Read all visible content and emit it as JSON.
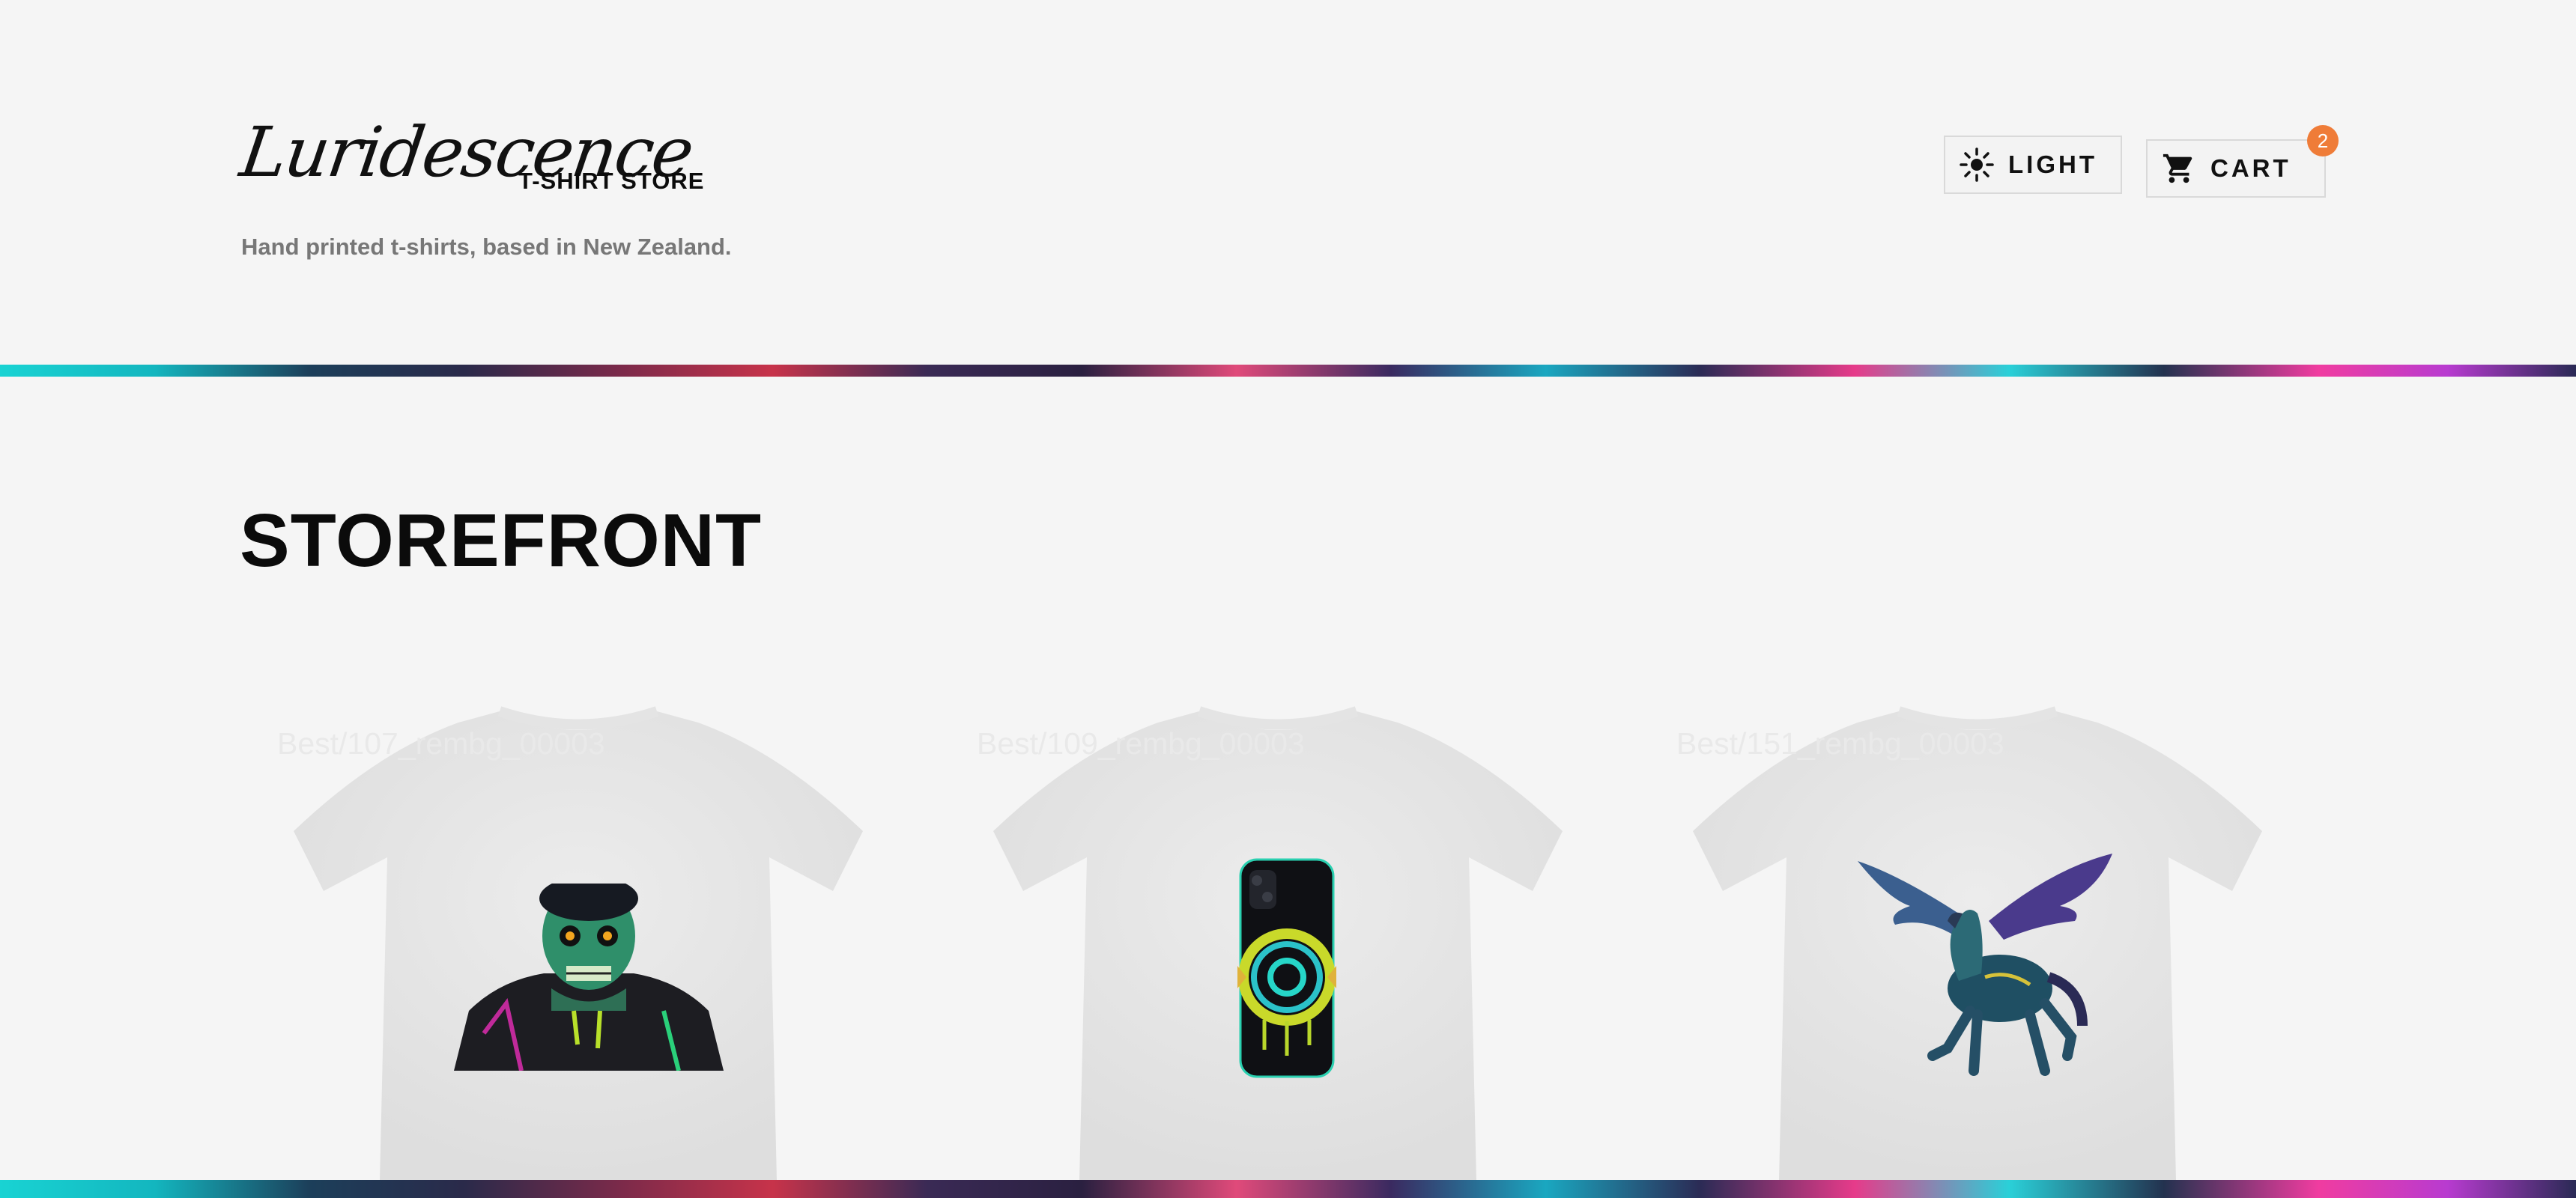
{
  "brand": {
    "logo_text": "Luridescence",
    "store_label": "T-SHIRT STORE",
    "tagline": "Hand printed t-shirts, based in New Zealand."
  },
  "header": {
    "theme_button": {
      "label": "LIGHT",
      "icon": "sun-icon"
    },
    "cart_button": {
      "label": "CART",
      "icon": "cart-icon",
      "count": "2"
    }
  },
  "main": {
    "title": "STOREFRONT",
    "products": [
      {
        "alt_text": "Best/107_rembg_00003",
        "design": "zombie"
      },
      {
        "alt_text": "Best/109_rembg_00003",
        "design": "phone"
      },
      {
        "alt_text": "Best/151_rembg_00003",
        "design": "pegasus"
      }
    ]
  },
  "colors": {
    "background": "#f5f5f5",
    "text": "#0b0b0b",
    "muted": "#777777",
    "badge": "#ef7c38"
  }
}
